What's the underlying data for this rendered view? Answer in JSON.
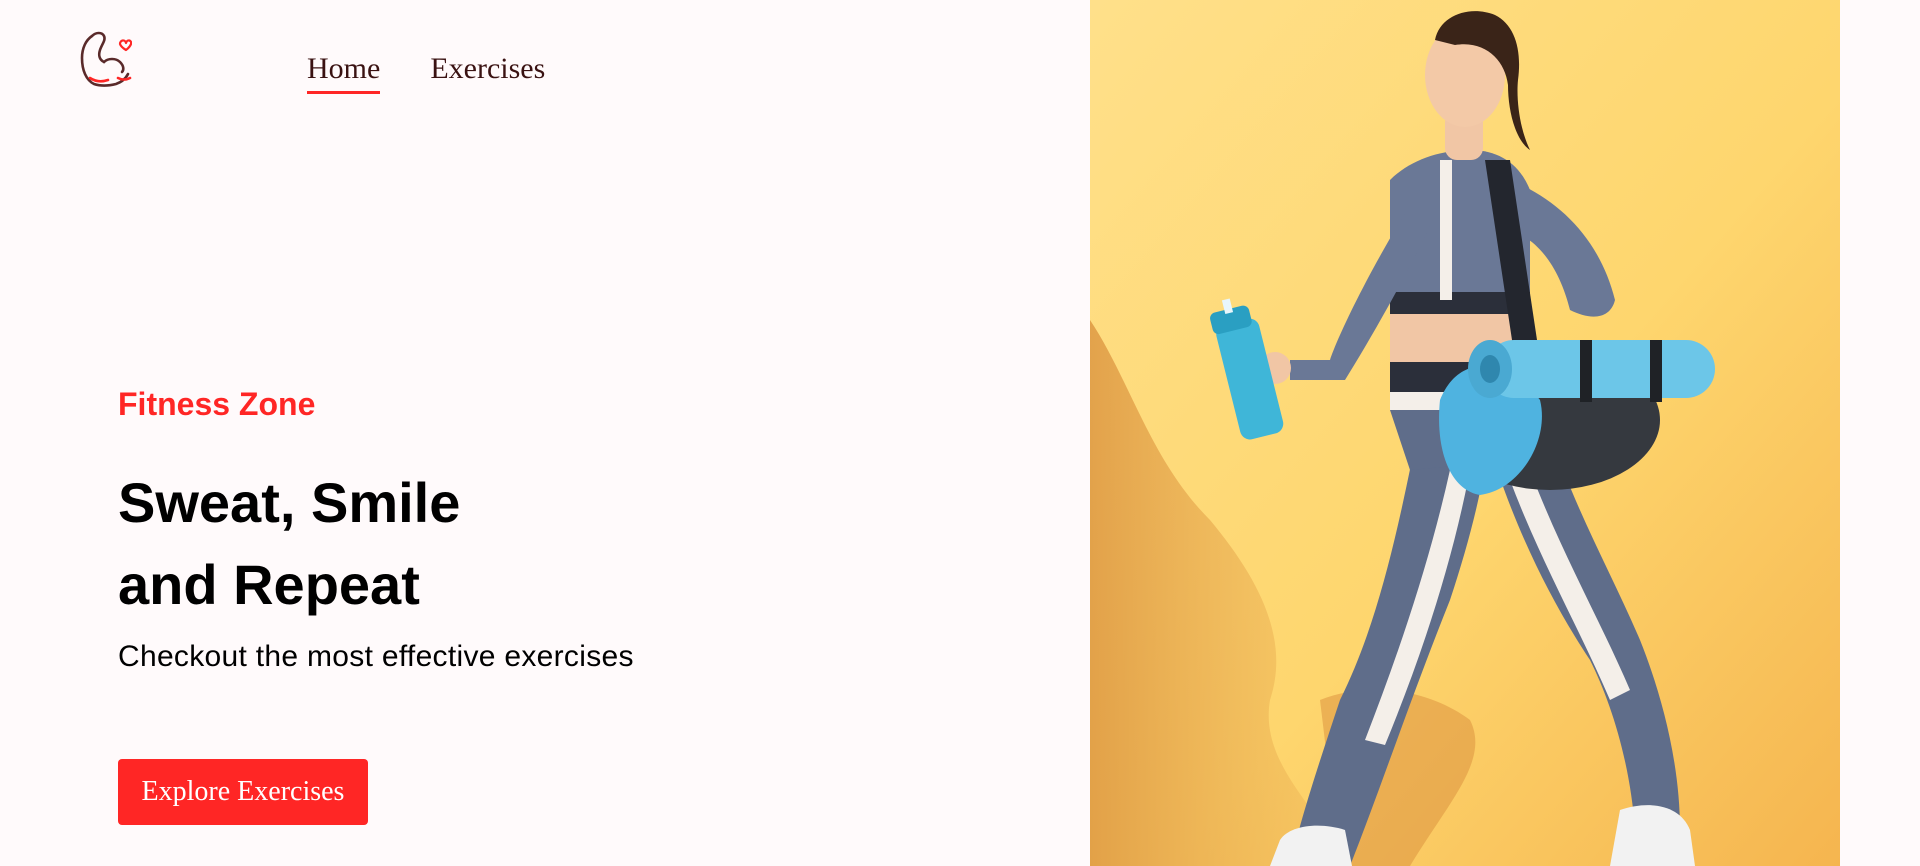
{
  "nav": {
    "logo_icon": "flexed-arm-heart-icon",
    "items": [
      {
        "label": "Home",
        "active": true
      },
      {
        "label": "Exercises",
        "active": false
      }
    ]
  },
  "hero": {
    "kicker": "Fitness Zone",
    "title_line1": "Sweat, Smile",
    "title_line2": "and Repeat",
    "subtitle": "Checkout the most effective exercises",
    "cta_label": "Explore Exercises"
  },
  "banner": {
    "image": "woman-walking-with-gym-bag-and-shaker-photo",
    "background_color": "#fed66e"
  },
  "colors": {
    "accent": "#ff2625",
    "nav_text": "#3a1212",
    "page_bg": "#fffafb"
  }
}
